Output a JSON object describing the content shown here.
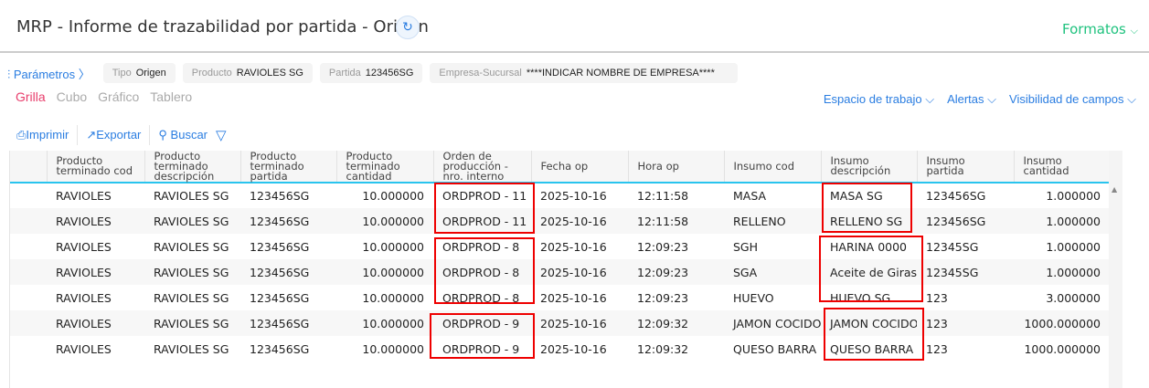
{
  "header": {
    "title": "MRP - Informe de trazabilidad por partida - Origen",
    "formatos": "Formatos"
  },
  "params": {
    "label": "Parámetros",
    "chips": [
      {
        "k": "Tipo",
        "v": "Origen"
      },
      {
        "k": "Producto",
        "v": "RAVIOLES SG"
      },
      {
        "k": "Partida",
        "v": "123456SG"
      },
      {
        "k": "Empresa-Sucursal",
        "v": "****INDICAR NOMBRE DE EMPRESA****"
      }
    ]
  },
  "tabs": [
    "Grilla",
    "Cubo",
    "Gráfico",
    "Tablero"
  ],
  "rightmenu": [
    "Espacio de trabajo",
    "Alertas",
    "Visibilidad de campos"
  ],
  "toolbar": {
    "print": "Imprimir",
    "export": "Exportar",
    "search": "Buscar"
  },
  "table": {
    "columns": [
      "Producto terminado cod",
      "Producto terminado descripción",
      "Producto terminado partida",
      "Producto terminado cantidad",
      "Orden de producción - nro. interno",
      "Fecha op",
      "Hora op",
      "Insumo cod",
      "Insumo descripción",
      "Insumo partida",
      "Insumo cantidad"
    ],
    "rows": [
      [
        "RAVIOLES",
        "RAVIOLES SG",
        "123456SG",
        "10.000000",
        "ORDPROD - 11",
        "2025-10-16",
        "12:11:58",
        "MASA",
        "MASA SG",
        "123456SG",
        "1.000000"
      ],
      [
        "RAVIOLES",
        "RAVIOLES SG",
        "123456SG",
        "10.000000",
        "ORDPROD - 11",
        "2025-10-16",
        "12:11:58",
        "RELLENO",
        "RELLENO SG",
        "123456SG",
        "1.000000"
      ],
      [
        "RAVIOLES",
        "RAVIOLES SG",
        "123456SG",
        "10.000000",
        "ORDPROD - 8",
        "2025-10-16",
        "12:09:23",
        "SGH",
        "HARINA 0000",
        "12345SG",
        "1.000000"
      ],
      [
        "RAVIOLES",
        "RAVIOLES SG",
        "123456SG",
        "10.000000",
        "ORDPROD - 8",
        "2025-10-16",
        "12:09:23",
        "SGA",
        "Aceite de Girasol",
        "12345SG",
        "1.000000"
      ],
      [
        "RAVIOLES",
        "RAVIOLES SG",
        "123456SG",
        "10.000000",
        "ORDPROD - 8",
        "2025-10-16",
        "12:09:23",
        "HUEVO",
        "HUEVO SG",
        "123",
        "3.000000"
      ],
      [
        "RAVIOLES",
        "RAVIOLES SG",
        "123456SG",
        "10.000000",
        "ORDPROD - 9",
        "2025-10-16",
        "12:09:32",
        "JAMON COCIDO",
        "JAMON COCIDO",
        "123",
        "1000.000000"
      ],
      [
        "RAVIOLES",
        "RAVIOLES SG",
        "123456SG",
        "10.000000",
        "ORDPROD - 9",
        "2025-10-16",
        "12:09:32",
        "QUESO BARRA",
        "QUESO BARRA",
        "123",
        "1000.000000"
      ]
    ]
  }
}
